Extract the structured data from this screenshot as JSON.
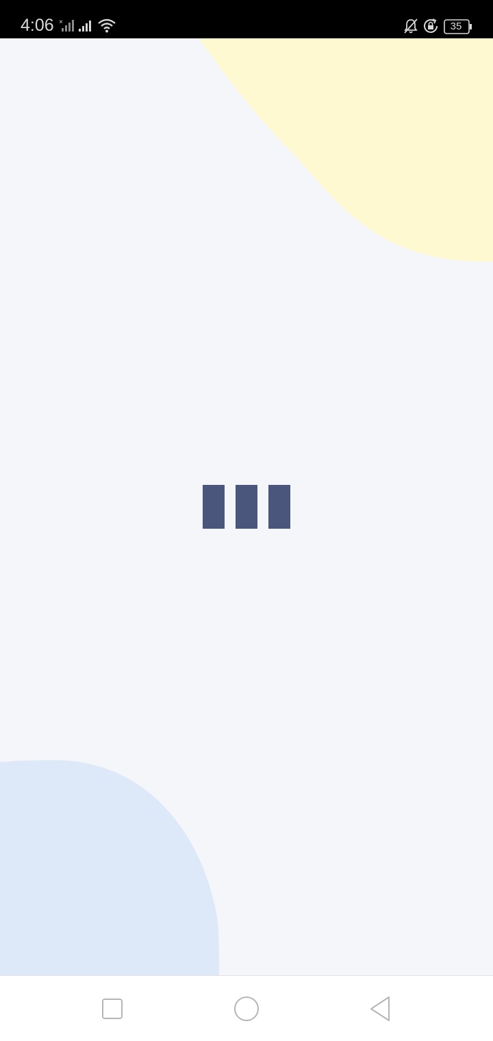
{
  "status_bar": {
    "time": "4:06",
    "battery_level": "35",
    "icons": [
      "signal-no-sim-icon",
      "signal-icon",
      "wifi-icon",
      "bell-off-icon",
      "rotation-lock-icon",
      "battery-icon"
    ]
  },
  "loader": {
    "bar_count": 3,
    "color": "#4b567c"
  },
  "background": {
    "base_color": "#f4f6f9",
    "blob_top_right_color": "#fff9d2",
    "blob_bottom_left_color": "#dde9f8"
  },
  "nav_bar": {
    "icons": [
      "recents-square-icon",
      "home-circle-icon",
      "back-triangle-icon"
    ]
  }
}
